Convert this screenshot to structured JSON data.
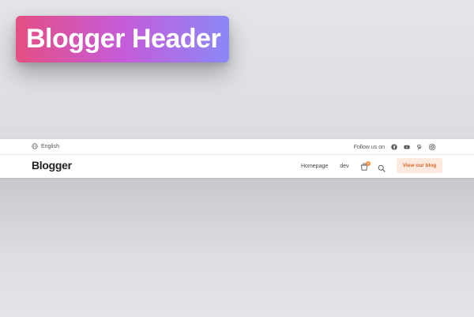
{
  "badge": {
    "title": "Blogger Header"
  },
  "topbar": {
    "language": "English",
    "follow_label": "Follow us on",
    "social_icons": [
      "facebook-icon",
      "youtube-icon",
      "pinterest-icon",
      "instagram-icon"
    ]
  },
  "mainbar": {
    "logo": "Blogger",
    "nav": [
      "Homepage",
      "dev"
    ],
    "cart_count": "0",
    "cta_label": "View our blog"
  },
  "colors": {
    "badge_gradient": [
      "#e44f83",
      "#c65bd9",
      "#8b88f7"
    ],
    "accent": "#d8692c",
    "cta_background": "#fde9de",
    "cart_badge": "#f28a3b"
  }
}
